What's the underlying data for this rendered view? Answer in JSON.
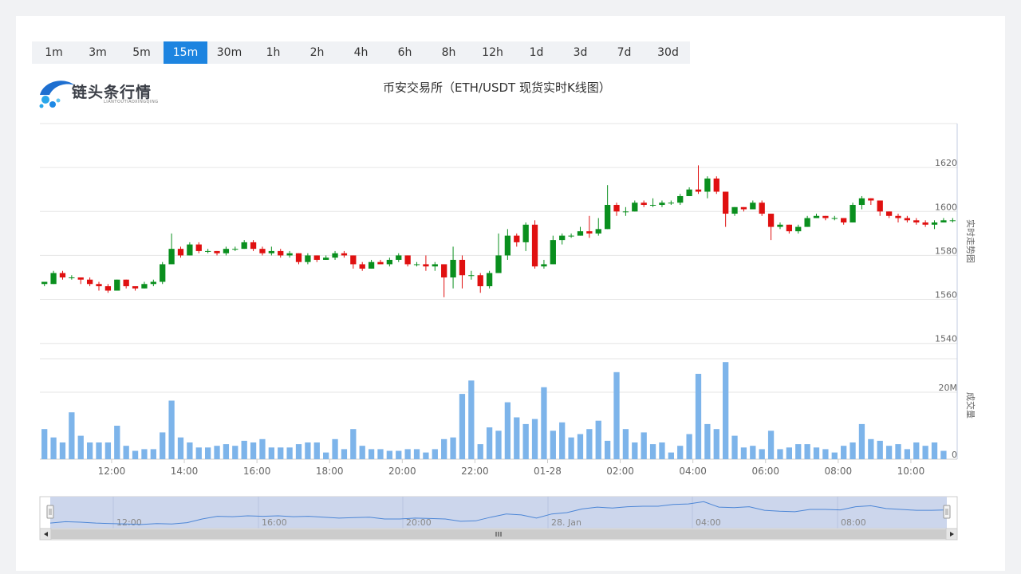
{
  "intervals": [
    "1m",
    "3m",
    "5m",
    "15m",
    "30m",
    "1h",
    "2h",
    "4h",
    "6h",
    "8h",
    "12h",
    "1d",
    "3d",
    "7d",
    "30d"
  ],
  "active_interval": "15m",
  "logo": {
    "text": "链头条行情",
    "sub": "LIANTOUTIAOXINGQING"
  },
  "chart_data": {
    "type": "candlestick",
    "title": "币安交易所（ETH/USDT 现货实时K线图）",
    "price_axis": {
      "label": "实时走势图",
      "ticks": [
        1540,
        1560,
        1580,
        1600,
        1620
      ],
      "range": [
        1533,
        1640
      ]
    },
    "volume_axis": {
      "label": "成交量",
      "ticks": [
        "0",
        "20M"
      ],
      "range": [
        0,
        30
      ]
    },
    "time_ticks": [
      {
        "label": "12:00",
        "at": 7.9
      },
      {
        "label": "14:00",
        "at": 15.9
      },
      {
        "label": "16:00",
        "at": 23.9
      },
      {
        "label": "18:00",
        "at": 31.9
      },
      {
        "label": "20:00",
        "at": 39.9
      },
      {
        "label": "22:00",
        "at": 47.9
      },
      {
        "label": "01-28",
        "at": 55.9
      },
      {
        "label": "02:00",
        "at": 63.9
      },
      {
        "label": "04:00",
        "at": 71.9
      },
      {
        "label": "06:00",
        "at": 79.9
      },
      {
        "label": "08:00",
        "at": 87.9
      },
      {
        "label": "10:00",
        "at": 95.9
      }
    ],
    "candles": [
      [
        1567,
        1568,
        1568,
        1566
      ],
      [
        1567,
        1572,
        1573,
        1567
      ],
      [
        1572,
        1570,
        1573,
        1569
      ],
      [
        1570,
        1570,
        1571,
        1569
      ],
      [
        1570,
        1569,
        1570,
        1567
      ],
      [
        1569,
        1567,
        1570,
        1566
      ],
      [
        1567,
        1566,
        1568,
        1564
      ],
      [
        1566,
        1564,
        1567,
        1563
      ],
      [
        1564,
        1569,
        1569,
        1564
      ],
      [
        1569,
        1566,
        1569,
        1565
      ],
      [
        1566,
        1565,
        1566,
        1564
      ],
      [
        1565,
        1567,
        1568,
        1565
      ],
      [
        1567,
        1568,
        1569,
        1566
      ],
      [
        1568,
        1576,
        1577,
        1567
      ],
      [
        1576,
        1583,
        1590,
        1576
      ],
      [
        1583,
        1580,
        1584,
        1579
      ],
      [
        1580,
        1585,
        1586,
        1580
      ],
      [
        1585,
        1582,
        1586,
        1581
      ],
      [
        1582,
        1582,
        1583,
        1581
      ],
      [
        1582,
        1581,
        1582,
        1580
      ],
      [
        1581,
        1583,
        1584,
        1580
      ],
      [
        1583,
        1583,
        1584,
        1582
      ],
      [
        1583,
        1586,
        1587,
        1583
      ],
      [
        1586,
        1583,
        1587,
        1582
      ],
      [
        1583,
        1581,
        1584,
        1580
      ],
      [
        1581,
        1582,
        1584,
        1580
      ],
      [
        1582,
        1580,
        1583,
        1579
      ],
      [
        1580,
        1581,
        1582,
        1579
      ],
      [
        1581,
        1577,
        1581,
        1576
      ],
      [
        1577,
        1580,
        1581,
        1576
      ],
      [
        1580,
        1578,
        1580,
        1577
      ],
      [
        1578,
        1579,
        1580,
        1578
      ],
      [
        1579,
        1581,
        1582,
        1578
      ],
      [
        1581,
        1580,
        1582,
        1579
      ],
      [
        1580,
        1576,
        1580,
        1574
      ],
      [
        1576,
        1574,
        1577,
        1573
      ],
      [
        1574,
        1577,
        1578,
        1574
      ],
      [
        1577,
        1576,
        1578,
        1576
      ],
      [
        1576,
        1578,
        1579,
        1575
      ],
      [
        1578,
        1580,
        1581,
        1577
      ],
      [
        1580,
        1576,
        1580,
        1575
      ],
      [
        1576,
        1576,
        1577,
        1575
      ],
      [
        1576,
        1575,
        1580,
        1573
      ],
      [
        1575,
        1576,
        1577,
        1573
      ],
      [
        1576,
        1570,
        1576,
        1561
      ],
      [
        1570,
        1578,
        1584,
        1565
      ],
      [
        1578,
        1571,
        1580,
        1565
      ],
      [
        1571,
        1571,
        1573,
        1569
      ],
      [
        1571,
        1566,
        1572,
        1563
      ],
      [
        1566,
        1572,
        1573,
        1565
      ],
      [
        1572,
        1580,
        1590,
        1572
      ],
      [
        1580,
        1589,
        1592,
        1578
      ],
      [
        1589,
        1586,
        1590,
        1584
      ],
      [
        1586,
        1594,
        1595,
        1582
      ],
      [
        1594,
        1575,
        1596,
        1574
      ],
      [
        1575,
        1576,
        1578,
        1574
      ],
      [
        1576,
        1587,
        1589,
        1576
      ],
      [
        1587,
        1589,
        1590,
        1585
      ],
      [
        1589,
        1589,
        1590,
        1588
      ],
      [
        1589,
        1591,
        1593,
        1589
      ],
      [
        1591,
        1590,
        1598,
        1588
      ],
      [
        1590,
        1592,
        1597,
        1589
      ],
      [
        1592,
        1603,
        1612,
        1592
      ],
      [
        1603,
        1600,
        1604,
        1598
      ],
      [
        1600,
        1600,
        1602,
        1598
      ],
      [
        1600,
        1604,
        1605,
        1600
      ],
      [
        1604,
        1603,
        1605,
        1602
      ],
      [
        1603,
        1603,
        1606,
        1602
      ],
      [
        1603,
        1604,
        1605,
        1602
      ],
      [
        1604,
        1604,
        1605,
        1603
      ],
      [
        1604,
        1607,
        1608,
        1603
      ],
      [
        1607,
        1610,
        1611,
        1607
      ],
      [
        1610,
        1609,
        1621,
        1608
      ],
      [
        1609,
        1615,
        1616,
        1606
      ],
      [
        1615,
        1609,
        1616,
        1608
      ],
      [
        1609,
        1599,
        1609,
        1593
      ],
      [
        1599,
        1602,
        1602,
        1598
      ],
      [
        1602,
        1601,
        1602,
        1600
      ],
      [
        1601,
        1604,
        1605,
        1601
      ],
      [
        1604,
        1599,
        1605,
        1598
      ],
      [
        1599,
        1593,
        1599,
        1587
      ],
      [
        1593,
        1594,
        1595,
        1592
      ],
      [
        1594,
        1591,
        1594,
        1590
      ],
      [
        1591,
        1593,
        1594,
        1590
      ],
      [
        1593,
        1597,
        1598,
        1593
      ],
      [
        1597,
        1598,
        1599,
        1597
      ],
      [
        1598,
        1597,
        1598,
        1596
      ],
      [
        1597,
        1597,
        1598,
        1596
      ],
      [
        1597,
        1595,
        1597,
        1594
      ],
      [
        1595,
        1603,
        1604,
        1595
      ],
      [
        1603,
        1606,
        1607,
        1601
      ],
      [
        1606,
        1605,
        1606,
        1603
      ],
      [
        1605,
        1600,
        1605,
        1598
      ],
      [
        1600,
        1598,
        1600,
        1597
      ],
      [
        1598,
        1597,
        1599,
        1595
      ],
      [
        1597,
        1596,
        1598,
        1595
      ],
      [
        1596,
        1595,
        1597,
        1594
      ],
      [
        1595,
        1594,
        1596,
        1593
      ],
      [
        1594,
        1595,
        1596,
        1592
      ],
      [
        1595,
        1596,
        1597,
        1595
      ],
      [
        1596,
        1596,
        1597,
        1595
      ]
    ],
    "volume": [
      9,
      6.5,
      5,
      14,
      7,
      5,
      5,
      5,
      10,
      4,
      2.5,
      3,
      3,
      8,
      17.5,
      6.5,
      5,
      3.5,
      3.5,
      4,
      4.5,
      4,
      5.5,
      5,
      6,
      3.5,
      3.5,
      3.5,
      4.5,
      5,
      5,
      2,
      6,
      3,
      9,
      4,
      3,
      3,
      2.5,
      2.5,
      3,
      3,
      2,
      3,
      6,
      6.5,
      19.5,
      23.5,
      4.5,
      9.5,
      8.5,
      17,
      12.5,
      10.5,
      12,
      21.5,
      8.5,
      11,
      6.5,
      7.5,
      9,
      11.5,
      5.5,
      26,
      9,
      5,
      8,
      4.5,
      5,
      2,
      4,
      7.5,
      25.5,
      10.5,
      9,
      29,
      7,
      3.5,
      4,
      3,
      8.5,
      3,
      3.5,
      4.5,
      4.5,
      3.5,
      3,
      2,
      4,
      5,
      10.5,
      6,
      5.5,
      4,
      4.5,
      3,
      5,
      4,
      5,
      2.5
    ],
    "navigator": {
      "time_labels": [
        "12:00",
        "16:00",
        "20:00",
        "28. Jan",
        "04:00",
        "08:00"
      ],
      "line": [
        1567,
        1570,
        1569,
        1567,
        1566,
        1565,
        1564,
        1566,
        1565,
        1568,
        1576,
        1582,
        1581,
        1583,
        1582,
        1583,
        1581,
        1582,
        1580,
        1578,
        1579,
        1580,
        1576,
        1576,
        1578,
        1577,
        1576,
        1571,
        1572,
        1580,
        1587,
        1585,
        1578,
        1587,
        1590,
        1598,
        1602,
        1600,
        1603,
        1604,
        1604,
        1608,
        1609,
        1614,
        1602,
        1601,
        1603,
        1595,
        1593,
        1592,
        1597,
        1597,
        1596,
        1603,
        1605,
        1599,
        1597,
        1595,
        1595,
        1596
      ]
    }
  }
}
